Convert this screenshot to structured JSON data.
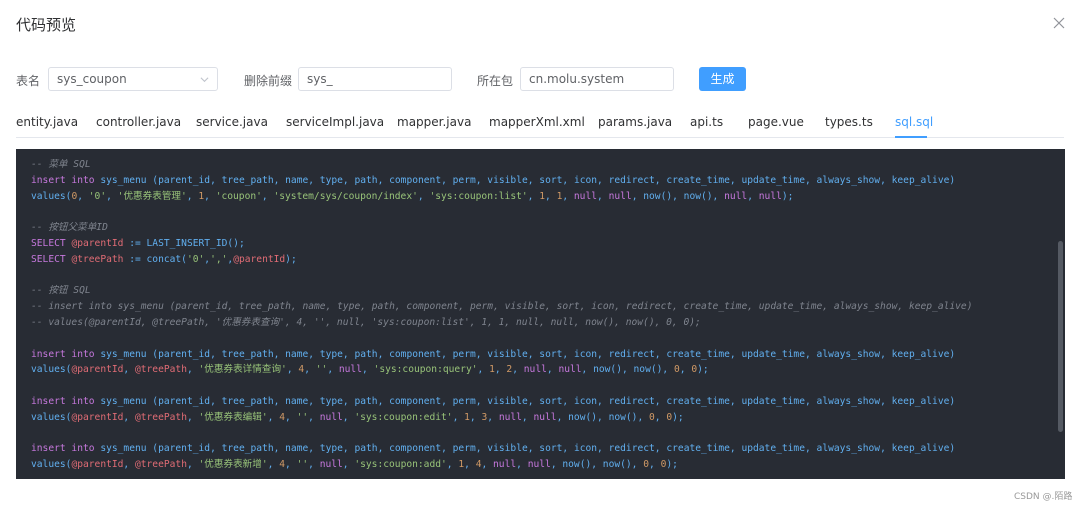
{
  "dialog": {
    "title": "代码预览"
  },
  "form": {
    "table_label": "表名",
    "table_value": "sys_coupon",
    "prefix_label": "删除前缀",
    "prefix_value": "sys_",
    "package_label": "所在包",
    "package_value": "cn.molu.system",
    "generate_label": "生成"
  },
  "tabs": [
    {
      "label": "entity.java"
    },
    {
      "label": "controller.java"
    },
    {
      "label": "service.java"
    },
    {
      "label": "serviceImpl.java"
    },
    {
      "label": "mapper.java"
    },
    {
      "label": "mapperXml.xml"
    },
    {
      "label": "params.java"
    },
    {
      "label": "api.ts"
    },
    {
      "label": "page.vue"
    },
    {
      "label": "types.ts"
    },
    {
      "label": "sql.sql"
    }
  ],
  "active_tab": "sql.sql",
  "code_lines": [
    [
      {
        "c": "cmt",
        "t": "-- 菜单 SQL"
      }
    ],
    [
      {
        "c": "kw",
        "t": "insert into"
      },
      {
        "c": "plain",
        "t": " sys_menu (parent_id, tree_path, name, type, path, component, perm, visible, sort, icon, redirect, create_time, update_time, always_show, keep_alive)"
      }
    ],
    [
      {
        "c": "plain",
        "t": "values("
      },
      {
        "c": "num",
        "t": "0"
      },
      {
        "c": "plain",
        "t": ", "
      },
      {
        "c": "str",
        "t": "'0'"
      },
      {
        "c": "plain",
        "t": ", "
      },
      {
        "c": "str",
        "t": "'优惠券表管理'"
      },
      {
        "c": "plain",
        "t": ", "
      },
      {
        "c": "num",
        "t": "1"
      },
      {
        "c": "plain",
        "t": ", "
      },
      {
        "c": "str",
        "t": "'coupon'"
      },
      {
        "c": "plain",
        "t": ", "
      },
      {
        "c": "str",
        "t": "'system/sys/coupon/index'"
      },
      {
        "c": "plain",
        "t": ", "
      },
      {
        "c": "str",
        "t": "'sys:coupon:list'"
      },
      {
        "c": "plain",
        "t": ", "
      },
      {
        "c": "num",
        "t": "1"
      },
      {
        "c": "plain",
        "t": ", "
      },
      {
        "c": "num",
        "t": "1"
      },
      {
        "c": "plain",
        "t": ", "
      },
      {
        "c": "kw",
        "t": "null"
      },
      {
        "c": "plain",
        "t": ", "
      },
      {
        "c": "kw",
        "t": "null"
      },
      {
        "c": "plain",
        "t": ", now(), now(), "
      },
      {
        "c": "kw",
        "t": "null"
      },
      {
        "c": "plain",
        "t": ", "
      },
      {
        "c": "kw",
        "t": "null"
      },
      {
        "c": "plain",
        "t": ");"
      }
    ],
    [],
    [
      {
        "c": "cmt",
        "t": "-- 按钮父菜单ID"
      }
    ],
    [
      {
        "c": "kw",
        "t": "SELECT"
      },
      {
        "c": "plain",
        "t": " "
      },
      {
        "c": "var",
        "t": "@parentId"
      },
      {
        "c": "plain",
        "t": " := LAST_INSERT_ID();"
      }
    ],
    [
      {
        "c": "kw",
        "t": "SELECT"
      },
      {
        "c": "plain",
        "t": " "
      },
      {
        "c": "var",
        "t": "@treePath"
      },
      {
        "c": "plain",
        "t": " := concat("
      },
      {
        "c": "str",
        "t": "'0'"
      },
      {
        "c": "plain",
        "t": ","
      },
      {
        "c": "str",
        "t": "','"
      },
      {
        "c": "plain",
        "t": ","
      },
      {
        "c": "var",
        "t": "@parentId"
      },
      {
        "c": "plain",
        "t": ");"
      }
    ],
    [],
    [
      {
        "c": "cmt",
        "t": "-- 按钮 SQL"
      }
    ],
    [
      {
        "c": "cmt",
        "t": "-- insert into sys_menu (parent_id, tree_path, name, type, path, component, perm, visible, sort, icon, redirect, create_time, update_time, always_show, keep_alive)"
      }
    ],
    [
      {
        "c": "cmt",
        "t": "-- values(@parentId, @treePath, '优惠券表查询', 4, '', null, 'sys:coupon:list', 1, 1, null, null, now(), now(), 0, 0);"
      }
    ],
    [],
    [
      {
        "c": "kw",
        "t": "insert into"
      },
      {
        "c": "plain",
        "t": " sys_menu (parent_id, tree_path, name, type, path, component, perm, visible, sort, icon, redirect, create_time, update_time, always_show, keep_alive)"
      }
    ],
    [
      {
        "c": "plain",
        "t": "values("
      },
      {
        "c": "var",
        "t": "@parentId"
      },
      {
        "c": "plain",
        "t": ", "
      },
      {
        "c": "var",
        "t": "@treePath"
      },
      {
        "c": "plain",
        "t": ", "
      },
      {
        "c": "str",
        "t": "'优惠券表详情查询'"
      },
      {
        "c": "plain",
        "t": ", "
      },
      {
        "c": "num",
        "t": "4"
      },
      {
        "c": "plain",
        "t": ", "
      },
      {
        "c": "str",
        "t": "''"
      },
      {
        "c": "plain",
        "t": ", "
      },
      {
        "c": "kw",
        "t": "null"
      },
      {
        "c": "plain",
        "t": ", "
      },
      {
        "c": "str",
        "t": "'sys:coupon:query'"
      },
      {
        "c": "plain",
        "t": ", "
      },
      {
        "c": "num",
        "t": "1"
      },
      {
        "c": "plain",
        "t": ", "
      },
      {
        "c": "num",
        "t": "2"
      },
      {
        "c": "plain",
        "t": ", "
      },
      {
        "c": "kw",
        "t": "null"
      },
      {
        "c": "plain",
        "t": ", "
      },
      {
        "c": "kw",
        "t": "null"
      },
      {
        "c": "plain",
        "t": ", now(), now(), "
      },
      {
        "c": "num",
        "t": "0"
      },
      {
        "c": "plain",
        "t": ", "
      },
      {
        "c": "num",
        "t": "0"
      },
      {
        "c": "plain",
        "t": ");"
      }
    ],
    [],
    [
      {
        "c": "kw",
        "t": "insert into"
      },
      {
        "c": "plain",
        "t": " sys_menu (parent_id, tree_path, name, type, path, component, perm, visible, sort, icon, redirect, create_time, update_time, always_show, keep_alive)"
      }
    ],
    [
      {
        "c": "plain",
        "t": "values("
      },
      {
        "c": "var",
        "t": "@parentId"
      },
      {
        "c": "plain",
        "t": ", "
      },
      {
        "c": "var",
        "t": "@treePath"
      },
      {
        "c": "plain",
        "t": ", "
      },
      {
        "c": "str",
        "t": "'优惠券表编辑'"
      },
      {
        "c": "plain",
        "t": ", "
      },
      {
        "c": "num",
        "t": "4"
      },
      {
        "c": "plain",
        "t": ", "
      },
      {
        "c": "str",
        "t": "''"
      },
      {
        "c": "plain",
        "t": ", "
      },
      {
        "c": "kw",
        "t": "null"
      },
      {
        "c": "plain",
        "t": ", "
      },
      {
        "c": "str",
        "t": "'sys:coupon:edit'"
      },
      {
        "c": "plain",
        "t": ", "
      },
      {
        "c": "num",
        "t": "1"
      },
      {
        "c": "plain",
        "t": ", "
      },
      {
        "c": "num",
        "t": "3"
      },
      {
        "c": "plain",
        "t": ", "
      },
      {
        "c": "kw",
        "t": "null"
      },
      {
        "c": "plain",
        "t": ", "
      },
      {
        "c": "kw",
        "t": "null"
      },
      {
        "c": "plain",
        "t": ", now(), now(), "
      },
      {
        "c": "num",
        "t": "0"
      },
      {
        "c": "plain",
        "t": ", "
      },
      {
        "c": "num",
        "t": "0"
      },
      {
        "c": "plain",
        "t": ");"
      }
    ],
    [],
    [
      {
        "c": "kw",
        "t": "insert into"
      },
      {
        "c": "plain",
        "t": " sys_menu (parent_id, tree_path, name, type, path, component, perm, visible, sort, icon, redirect, create_time, update_time, always_show, keep_alive)"
      }
    ],
    [
      {
        "c": "plain",
        "t": "values("
      },
      {
        "c": "var",
        "t": "@parentId"
      },
      {
        "c": "plain",
        "t": ", "
      },
      {
        "c": "var",
        "t": "@treePath"
      },
      {
        "c": "plain",
        "t": ", "
      },
      {
        "c": "str",
        "t": "'优惠券表新增'"
      },
      {
        "c": "plain",
        "t": ", "
      },
      {
        "c": "num",
        "t": "4"
      },
      {
        "c": "plain",
        "t": ", "
      },
      {
        "c": "str",
        "t": "''"
      },
      {
        "c": "plain",
        "t": ", "
      },
      {
        "c": "kw",
        "t": "null"
      },
      {
        "c": "plain",
        "t": ", "
      },
      {
        "c": "str",
        "t": "'sys:coupon:add'"
      },
      {
        "c": "plain",
        "t": ", "
      },
      {
        "c": "num",
        "t": "1"
      },
      {
        "c": "plain",
        "t": ", "
      },
      {
        "c": "num",
        "t": "4"
      },
      {
        "c": "plain",
        "t": ", "
      },
      {
        "c": "kw",
        "t": "null"
      },
      {
        "c": "plain",
        "t": ", "
      },
      {
        "c": "kw",
        "t": "null"
      },
      {
        "c": "plain",
        "t": ", now(), now(), "
      },
      {
        "c": "num",
        "t": "0"
      },
      {
        "c": "plain",
        "t": ", "
      },
      {
        "c": "num",
        "t": "0"
      },
      {
        "c": "plain",
        "t": ");"
      }
    ]
  ],
  "watermark": "CSDN @.陌路",
  "colors": {
    "accent": "#409eff",
    "code_bg": "#282c34"
  },
  "icons": {
    "close": "close-icon",
    "select": "chevron-down-icon"
  }
}
